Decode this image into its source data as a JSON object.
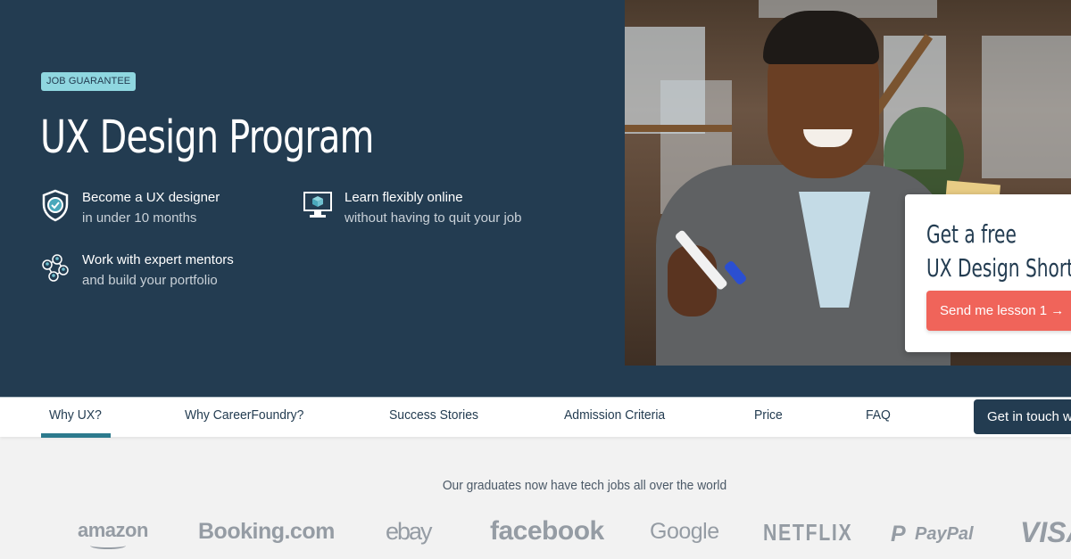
{
  "hero": {
    "badge": "JOB GUARANTEE",
    "title": "UX Design Program",
    "features": [
      {
        "icon": "shield-check-icon",
        "title": "Become a UX designer",
        "subtitle": "in under 10 months"
      },
      {
        "icon": "monitor-icon",
        "title": "Learn flexibly online",
        "subtitle": "without having to quit your job"
      },
      {
        "icon": "mentors-network-icon",
        "title": "Work with expert mentors",
        "subtitle": "and build your portfolio"
      }
    ],
    "background_color": "#233c51",
    "badge_color": "#8fd7e0"
  },
  "promo_card": {
    "title_line1": "Get a free",
    "title_line2": "UX Design Short Course",
    "button_label": "Send me lesson 1 →",
    "button_color": "#f0645a"
  },
  "nav": {
    "items": [
      {
        "label": "Why UX?",
        "active": true
      },
      {
        "label": "Why CareerFoundry?",
        "active": false
      },
      {
        "label": "Success Stories",
        "active": false
      },
      {
        "label": "Admission Criteria",
        "active": false
      },
      {
        "label": "Price",
        "active": false
      },
      {
        "label": "FAQ",
        "active": false
      }
    ],
    "contact_button": "Get in touch with us",
    "active_color": "#2c7a8d"
  },
  "employers": {
    "tagline": "Our graduates now have tech jobs all over the world",
    "logos": [
      "amazon",
      "Booking.com",
      "ebay",
      "facebook",
      "Google",
      "NETFLIX",
      "PayPal",
      "VISA"
    ]
  }
}
